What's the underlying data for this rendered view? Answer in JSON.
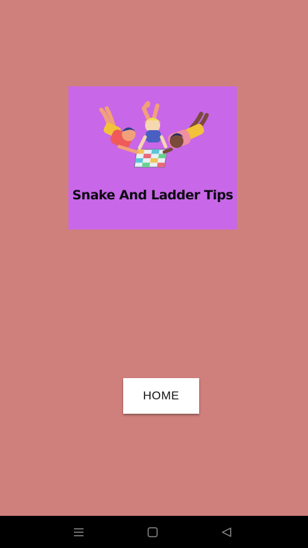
{
  "banner": {
    "title": "Snake And Ladder Tips",
    "background_color": "#c867e8"
  },
  "home_button": {
    "label": "HOME"
  },
  "theme": {
    "page_background": "#cf7f7c",
    "navbar_background": "#000000"
  },
  "navbar": {
    "icons": [
      "menu-icon",
      "home-square-icon",
      "back-triangle-icon"
    ]
  }
}
